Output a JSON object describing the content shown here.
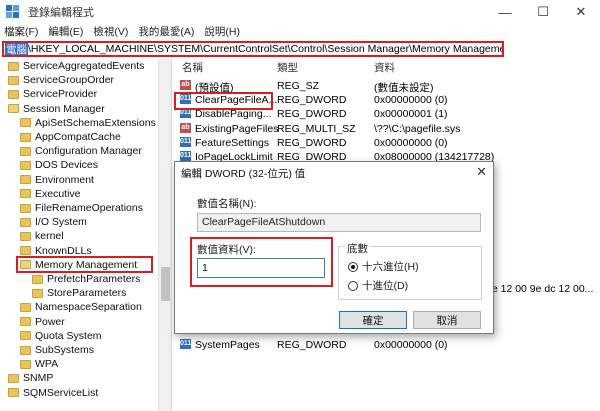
{
  "window": {
    "title": "登錄編輯程式",
    "minimize": "—",
    "maximize": "☐",
    "close": "✕"
  },
  "menu": [
    "檔案(F)",
    "編輯(E)",
    "檢視(V)",
    "我的最愛(A)",
    "說明(H)"
  ],
  "address": {
    "prefix": "電腦",
    "path": "\\HKEY_LOCAL_MACHINE\\SYSTEM\\CurrentControlSet\\Control\\Session Manager\\Memory Management"
  },
  "tree": [
    {
      "label": "ServiceAggregatedEvents",
      "indent": 0
    },
    {
      "label": "ServiceGroupOrder",
      "indent": 0
    },
    {
      "label": "ServiceProvider",
      "indent": 0
    },
    {
      "label": "Session Manager",
      "indent": 0,
      "open": true
    },
    {
      "label": "ApiSetSchemaExtensions",
      "indent": 1
    },
    {
      "label": "AppCompatCache",
      "indent": 1
    },
    {
      "label": "Configuration Manager",
      "indent": 1
    },
    {
      "label": "DOS Devices",
      "indent": 1
    },
    {
      "label": "Environment",
      "indent": 1
    },
    {
      "label": "Executive",
      "indent": 1
    },
    {
      "label": "FileRenameOperations",
      "indent": 1
    },
    {
      "label": "I/O System",
      "indent": 1
    },
    {
      "label": "kernel",
      "indent": 1
    },
    {
      "label": "KnownDLLs",
      "indent": 1
    },
    {
      "label": "Memory Management",
      "indent": 1,
      "open": true,
      "selected": true
    },
    {
      "label": "PrefetchParameters",
      "indent": 2
    },
    {
      "label": "StoreParameters",
      "indent": 2
    },
    {
      "label": "NamespaceSeparation",
      "indent": 1
    },
    {
      "label": "Power",
      "indent": 1
    },
    {
      "label": "Quota System",
      "indent": 1
    },
    {
      "label": "SubSystems",
      "indent": 1
    },
    {
      "label": "WPA",
      "indent": 1
    },
    {
      "label": "SNMP",
      "indent": 0
    },
    {
      "label": "SQMServiceList",
      "indent": 0
    }
  ],
  "list": {
    "headers": {
      "name": "名稱",
      "type": "類型",
      "data": "資料"
    },
    "rows": [
      {
        "icon": "ab",
        "name": "(預設值)",
        "type": "REG_SZ",
        "data": "(數值未設定)"
      },
      {
        "icon": "011",
        "name": "ClearPageFileA...",
        "type": "REG_DWORD",
        "data": "0x00000000 (0)"
      },
      {
        "icon": "011",
        "name": "DisablePaging...",
        "type": "REG_DWORD",
        "data": "0x00000001 (1)"
      },
      {
        "icon": "ab",
        "name": "ExistingPageFiles",
        "type": "REG_MULTI_SZ",
        "data": "\\??\\C:\\pagefile.sys"
      },
      {
        "icon": "011",
        "name": "FeatureSettings",
        "type": "REG_DWORD",
        "data": "0x00000000 (0)"
      },
      {
        "icon": "011",
        "name": "IoPageLockLimit",
        "type": "REG_DWORD",
        "data": "0x08000000 (134217728)"
      }
    ],
    "partial_data": "ae 12 00 9e dc 12 00...",
    "bottom_row": {
      "icon": "011",
      "name": "SystemPages",
      "type": "REG_DWORD",
      "data": "0x00000000 (0)"
    }
  },
  "dialog": {
    "title": "編輯 DWORD (32-位元) 值",
    "close": "✕",
    "name_label": "數值名稱(N):",
    "name_value": "ClearPageFileAtShutdown",
    "data_label": "數值資料(V):",
    "data_value": "1",
    "base_label": "底數",
    "radio_hex": "十六進位(H)",
    "radio_dec": "十進位(D)",
    "ok": "確定",
    "cancel": "取消"
  },
  "colors": {
    "highlight_red": "#d61f1f",
    "selection_blue": "#2a6ecb"
  }
}
